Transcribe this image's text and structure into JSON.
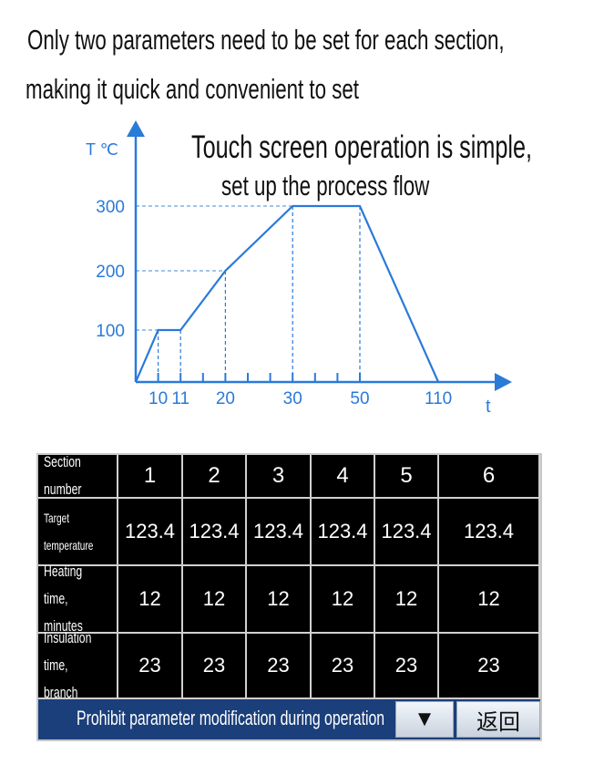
{
  "captions": {
    "line1": "Only two parameters need to be set for each section,",
    "line2": "making it quick and convenient to set",
    "touch1": "Touch screen operation is simple,",
    "touch2": "set up the process flow"
  },
  "chart_data": {
    "type": "line",
    "title": "",
    "ylabel": "T ℃",
    "xlabel": "t",
    "x_ticks": [
      "10",
      "11",
      "20",
      "30",
      "50",
      "110"
    ],
    "y_ticks": [
      "100",
      "200",
      "300"
    ],
    "series": [
      {
        "x": [
          0,
          10,
          11,
          20,
          30,
          50,
          110
        ],
        "y": [
          0,
          100,
          100,
          200,
          300,
          300,
          0
        ]
      }
    ],
    "grid": false,
    "reference_lines": "dashed guides from labeled points to axes",
    "color": "#2a7ad8"
  },
  "table": {
    "row_headers": [
      "Section number",
      "Target temperature",
      "Heating time, minutes",
      "Insulation time, branch"
    ],
    "sections": [
      "1",
      "2",
      "3",
      "4",
      "5",
      "6"
    ],
    "target_temperature": [
      "123.4",
      "123.4",
      "123.4",
      "123.4",
      "123.4",
      "123.4"
    ],
    "heating_time": [
      "12",
      "12",
      "12",
      "12",
      "12",
      "12"
    ],
    "insulation_time": [
      "23",
      "23",
      "23",
      "23",
      "23",
      "23"
    ]
  },
  "status_bar": {
    "message": "Prohibit parameter modification during operation",
    "dropdown_icon": "▼",
    "back_label": "返回",
    "color": "#1b3f7a"
  }
}
